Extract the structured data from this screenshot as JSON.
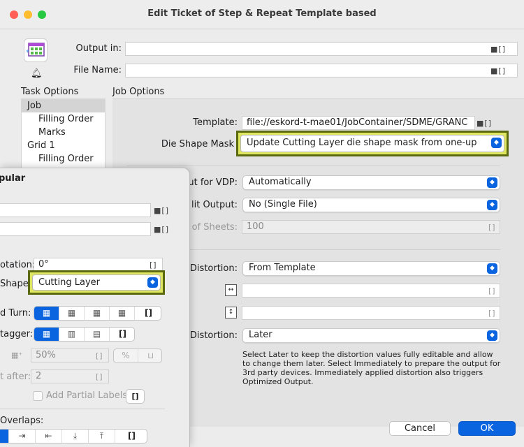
{
  "window": {
    "title": "Edit Ticket of Step & Repeat Template based",
    "colors": {
      "close": "#ff5f57",
      "minimize": "#febc2e",
      "zoom": "#28c840",
      "accent": "#0a64e0",
      "highlight": "#dfe65f"
    }
  },
  "header": {
    "output_in_label": "Output in:",
    "output_in_value": "",
    "file_name_label": "File Name:",
    "file_name_value": "",
    "folder_icon": "folder-icon",
    "bracket_glyph": "[]"
  },
  "task_options": {
    "title": "Task Options",
    "items": [
      {
        "label": "Job"
      },
      {
        "label": "Filling Order"
      },
      {
        "label": "Marks"
      },
      {
        "label": "Grid 1"
      },
      {
        "label": "Filling Order"
      }
    ]
  },
  "job_options": {
    "title": "Job Options",
    "template_label": "Template:",
    "template_value": "file://eskord-t-mae01/JobContainer/SDME/GRANC",
    "die_shape_mask_label": "Die Shape Mask",
    "die_shape_mask_value": "Update Cutting Layer die shape mask from one-up",
    "output_vdp_label": "ut for VDP:",
    "output_vdp_value": "Automatically",
    "split_output_label": "lit Output:",
    "split_output_value": "No (Single File)",
    "sheets_label": "of Sheets:",
    "sheets_value": "100",
    "distortion1_label": "Distortion:",
    "distortion1_value": "From Template",
    "distortion_h_value": "",
    "distortion_v_value": "",
    "distortion2_label": "Distortion:",
    "distortion2_value": "Later",
    "help_text": "Select Later to keep the distortion values fully editable and allow to change them later. Select Immediately to prepare the output for 3rd party devices. Immediately applied distortion also triggers Optimized Output."
  },
  "footer": {
    "cancel_label": "Cancel",
    "ok_label": "OK"
  },
  "overlay": {
    "title": "pular",
    "field1_value": "",
    "field2_value": "",
    "rotation_label": "otation:",
    "rotation_value": "0°",
    "shape_label": "Shape",
    "shape_value": "Cutting Layer",
    "turn_label": "d Turn:",
    "stagger_label": "tagger:",
    "percent_value": "50%",
    "percent_btn": "%",
    "after_label": "t after:",
    "after_value": "2",
    "partial_labels": "Add Partial Labels",
    "overlaps_label": "Overlaps:"
  }
}
